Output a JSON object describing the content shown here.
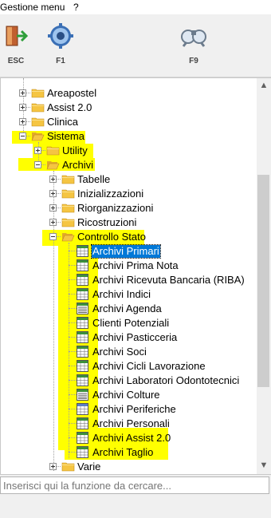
{
  "menu": {
    "items": [
      "Gestione menu",
      "?"
    ]
  },
  "toolbar": {
    "buttons": [
      {
        "label": "ESC",
        "icon": "exit-door-icon"
      },
      {
        "label": "F1",
        "icon": "gear-icon"
      },
      {
        "label": "F9",
        "icon": "binoculars-icon"
      }
    ]
  },
  "tree": {
    "nodes": [
      {
        "label": "Areapostel",
        "level": 1,
        "type": "folder",
        "expander": "plus"
      },
      {
        "label": "Assist 2.0",
        "level": 1,
        "type": "folder",
        "expander": "plus"
      },
      {
        "label": "Clinica",
        "level": 1,
        "type": "folder",
        "expander": "plus"
      },
      {
        "label": "Sistema",
        "level": 1,
        "type": "folder-open",
        "expander": "minus"
      },
      {
        "label": "Utility",
        "level": 2,
        "type": "folder",
        "expander": "plus"
      },
      {
        "label": "Archivi",
        "level": 2,
        "type": "folder-open",
        "expander": "minus"
      },
      {
        "label": "Tabelle",
        "level": 3,
        "type": "folder",
        "expander": "plus"
      },
      {
        "label": "Inizializzazioni",
        "level": 3,
        "type": "folder",
        "expander": "plus"
      },
      {
        "label": "Riorganizzazioni",
        "level": 3,
        "type": "folder",
        "expander": "plus"
      },
      {
        "label": "Ricostruzioni",
        "level": 3,
        "type": "folder",
        "expander": "plus"
      },
      {
        "label": "Controllo Stato",
        "level": 3,
        "type": "folder-open",
        "expander": "minus"
      },
      {
        "label": "Archivi Primari",
        "level": 4,
        "type": "table",
        "selected": true
      },
      {
        "label": "Archivi Prima Nota",
        "level": 4,
        "type": "table"
      },
      {
        "label": "Archivi Ricevuta Bancaria (RIBA)",
        "level": 4,
        "type": "table"
      },
      {
        "label": "Archivi Indici",
        "level": 4,
        "type": "table"
      },
      {
        "label": "Archivi Agenda",
        "level": 4,
        "type": "list"
      },
      {
        "label": "Clienti Potenziali",
        "level": 4,
        "type": "table"
      },
      {
        "label": "Archivi Pasticceria",
        "level": 4,
        "type": "table"
      },
      {
        "label": "Archivi Soci",
        "level": 4,
        "type": "table"
      },
      {
        "label": "Archivi Cicli Lavorazione",
        "level": 4,
        "type": "table"
      },
      {
        "label": "Archivi Laboratori Odontotecnici",
        "level": 4,
        "type": "table"
      },
      {
        "label": "Archivi Colture",
        "level": 4,
        "type": "list"
      },
      {
        "label": "Archivi Periferiche",
        "level": 4,
        "type": "table-blue"
      },
      {
        "label": "Archivi Personali",
        "level": 4,
        "type": "table"
      },
      {
        "label": "Archivi Assist 2.0",
        "level": 4,
        "type": "table"
      },
      {
        "label": "Archivi Taglio",
        "level": 4,
        "type": "table"
      },
      {
        "label": "Varie",
        "level": 3,
        "type": "folder",
        "expander": "plus"
      }
    ]
  },
  "search": {
    "placeholder": "Inserisci qui la funzione da cercare..."
  },
  "colors": {
    "highlight": "#ffff00",
    "selection": "#0078d7",
    "folder": "#f5c542"
  }
}
